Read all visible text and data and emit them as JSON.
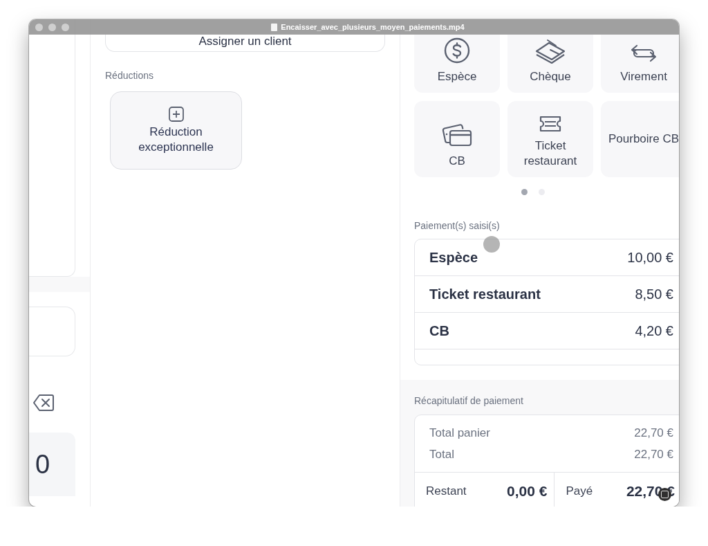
{
  "window": {
    "title": "Encaisser_avec_plusieurs_moyen_paiements.mp4"
  },
  "keypad": {
    "key": "0"
  },
  "customer": {
    "label": "Assigner un client"
  },
  "discounts": {
    "heading": "Réductions",
    "buttons": [
      {
        "label": "Réduction exceptionnelle"
      }
    ]
  },
  "payment_methods": {
    "tiles": [
      {
        "label": "Espèce",
        "kind": "cash"
      },
      {
        "label": "Chèque",
        "kind": "cheque"
      },
      {
        "label": "Virement",
        "kind": "transfer"
      },
      {
        "label": "CB",
        "kind": "card"
      },
      {
        "label": "Ticket restaurant",
        "kind": "voucher"
      },
      {
        "label": "Pourboire CB",
        "kind": "text"
      }
    ],
    "pages": [
      {
        "selected": true
      },
      {
        "selected": false
      }
    ]
  },
  "entered_payments": {
    "heading": "Paiement(s) saisi(s)",
    "rows": [
      {
        "method": "Espèce",
        "amount": "10,00 €"
      },
      {
        "method": "Ticket restaurant",
        "amount": "8,50 €"
      },
      {
        "method": "CB",
        "amount": "4,20 €"
      }
    ]
  },
  "summary": {
    "heading": "Récapitulatif de paiement",
    "lines": [
      {
        "label": "Total panier",
        "value": "22,70 €"
      },
      {
        "label": "Total",
        "value": "22,70 €"
      }
    ],
    "remaining": {
      "label": "Restant",
      "value": "0,00 €"
    },
    "paid": {
      "label": "Payé",
      "value": "22,70 €"
    }
  }
}
